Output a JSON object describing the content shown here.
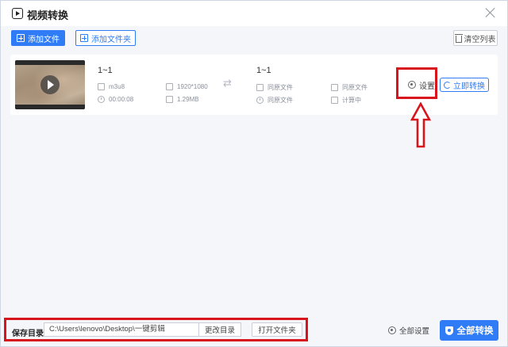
{
  "window": {
    "title": "视频转换"
  },
  "toolbar": {
    "add_file": "添加文件",
    "add_folder": "添加文件夹",
    "clear_list": "清空列表"
  },
  "file": {
    "source": {
      "name": "1~1",
      "format": "m3u8",
      "resolution": "1920*1080",
      "duration": "00:00:08",
      "size": "1.29MB"
    },
    "target": {
      "name": "1~1",
      "format": "同原文件",
      "resolution": "同原文件",
      "duration": "同原文件",
      "size": "计算中"
    },
    "settings_label": "设置",
    "convert_label": "立即转换"
  },
  "bottom": {
    "save_dir_label": "保存目录",
    "save_path": "C:\\Users\\lenovo\\Desktop\\一键剪辑",
    "change_dir": "更改目录",
    "open_folder": "打开文件夹",
    "all_settings": "全部设置",
    "convert_all": "全部转换"
  },
  "colors": {
    "accent": "#2f7cf6",
    "highlight": "#d8141c"
  }
}
